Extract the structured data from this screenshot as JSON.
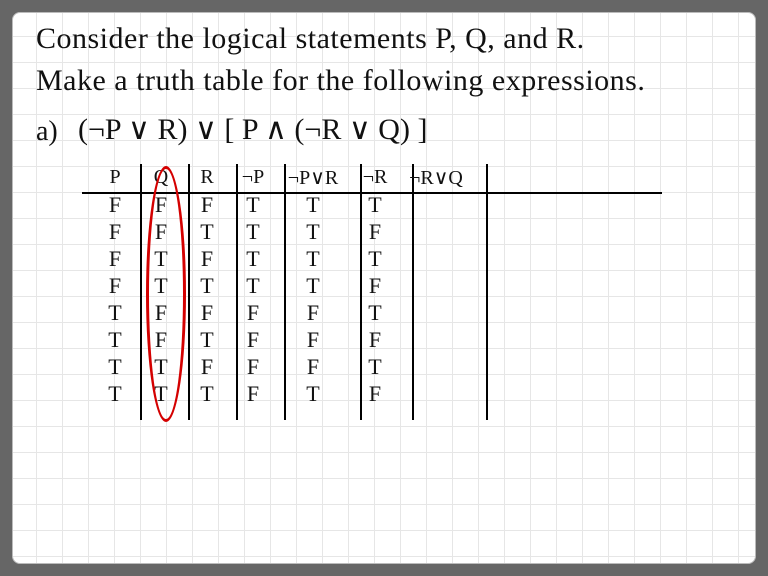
{
  "prompt": {
    "line1": "Consider the logical statements P, Q, and R.",
    "line2": "Make a truth table for the following expressions.",
    "item_label": "a)",
    "expression": "(¬P ∨ R) ∨ [ P ∧ (¬R ∨ Q) ]"
  },
  "table": {
    "headers": [
      "P",
      "Q",
      "R",
      "¬P",
      "¬P∨R",
      "¬R",
      "¬R∨Q"
    ],
    "rows": [
      [
        "F",
        "F",
        "F",
        "T",
        "T",
        "T",
        ""
      ],
      [
        "F",
        "F",
        "T",
        "T",
        "T",
        "F",
        ""
      ],
      [
        "F",
        "T",
        "F",
        "T",
        "T",
        "T",
        ""
      ],
      [
        "F",
        "T",
        "T",
        "T",
        "T",
        "F",
        ""
      ],
      [
        "T",
        "F",
        "F",
        "F",
        "F",
        "T",
        ""
      ],
      [
        "T",
        "F",
        "T",
        "F",
        "F",
        "F",
        ""
      ],
      [
        "T",
        "T",
        "F",
        "F",
        "F",
        "T",
        ""
      ],
      [
        "T",
        "T",
        "T",
        "F",
        "T",
        "F",
        ""
      ]
    ],
    "highlighted_column_index": 1
  },
  "chart_data": {
    "type": "table",
    "title": "Truth table construction for (¬P∨R) ∨ [P∧(¬R∨Q)]",
    "columns": [
      "P",
      "Q",
      "R",
      "¬P",
      "¬P∨R",
      "¬R",
      "¬R∨Q"
    ],
    "rows": [
      {
        "P": "F",
        "Q": "F",
        "R": "F",
        "¬P": "T",
        "¬P∨R": "T",
        "¬R": "T",
        "¬R∨Q": ""
      },
      {
        "P": "F",
        "Q": "F",
        "R": "T",
        "¬P": "T",
        "¬P∨R": "T",
        "¬R": "F",
        "¬R∨Q": ""
      },
      {
        "P": "F",
        "Q": "T",
        "R": "F",
        "¬P": "T",
        "¬P∨R": "T",
        "¬R": "T",
        "¬R∨Q": ""
      },
      {
        "P": "F",
        "Q": "T",
        "R": "T",
        "¬P": "T",
        "¬P∨R": "T",
        "¬R": "F",
        "¬R∨Q": ""
      },
      {
        "P": "T",
        "Q": "F",
        "R": "F",
        "¬P": "F",
        "¬P∨R": "F",
        "¬R": "T",
        "¬R∨Q": ""
      },
      {
        "P": "T",
        "Q": "F",
        "R": "T",
        "¬P": "F",
        "¬P∨R": "F",
        "¬R": "F",
        "¬R∨Q": ""
      },
      {
        "P": "T",
        "Q": "T",
        "R": "F",
        "¬P": "F",
        "¬P∨R": "F",
        "¬R": "T",
        "¬R∨Q": ""
      },
      {
        "P": "T",
        "Q": "T",
        "R": "T",
        "¬P": "F",
        "¬P∨R": "T",
        "¬R": "F",
        "¬R∨Q": ""
      }
    ],
    "highlighted_column": "Q"
  }
}
